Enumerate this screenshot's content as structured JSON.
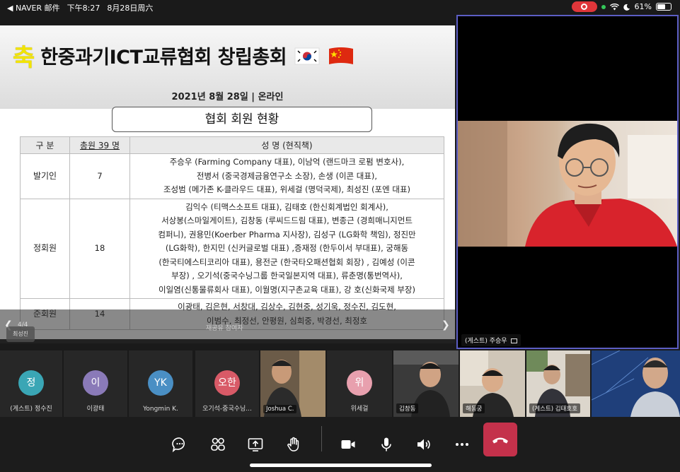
{
  "status_bar": {
    "back_app": "◀ NAVER 邮件",
    "time": "下午8:27",
    "date": "8月28日周六",
    "battery": "61%",
    "battery_level": 0.61
  },
  "slide": {
    "title_mark": "축",
    "title": "한중과기ICT교류협회 창립총회",
    "date_line": "2021년 8월 28일  |  온라인",
    "box_title": "협회 회원 현황",
    "table": {
      "headers": [
        "구 분",
        "총원 39 명",
        "성 명  (현직책)"
      ],
      "rows": [
        {
          "category": "발기인",
          "count": "7",
          "names": [
            "주승우 (Farming Company 대표), 이남억 (랜드마크 로펌 변호사),",
            "전병서 (중국경제금융연구소 소장), 손생 (이콘 대표),",
            "조성범 (메가존 K-클라우드 대표), 위세걸 (명덕국제), 최성진 (포엔 대표)"
          ]
        },
        {
          "category": "정회원",
          "count": "18",
          "names": [
            "김익수 (티맥스소프트 대표), 김태호 (한신회계법인 회계사),",
            "서상봉(스마일게이트), 김창동 (루씨드드림 대표), 변종근 (경희매니지먼트",
            "컴퍼니), 권용민(Koerber Pharma 지사장), 김성구 (LG화학 책임), 정진만",
            "(LG화학), 한지민 (신커글로벌 대표) ,증재정 (한두이서 부대표), 궁해동",
            "(한국티에스티코리아 대표), 용전군 (한국타오패션협회 회장) , 김예성 (이콘",
            "부장) , 오기석(중국수닝그룹 한국일본지역 대표), 류춘명(통번역사),",
            "이일염(신통물류회사 대표), 이월명(지구촌교육 대표), 강 호(신화국제 부장)"
          ]
        },
        {
          "category": "준회원",
          "count": "14",
          "names": [
            "이광태, 김은현, 서창대, 김상수, 김현중, 성기욱, 정수진, 김도현,",
            "이범수, 최정선, 안평원, 심희중, 박경선, 최정호"
          ]
        }
      ]
    },
    "overlay": {
      "page_counter": "4/4",
      "presenter_chip": "최성진",
      "mid_text": "재공유 참여자"
    }
  },
  "main_video": {
    "label": "(게스트) 주승우"
  },
  "participants": [
    {
      "name": "(게스트) 정수진",
      "initials": "정",
      "color": "#3aa6b5",
      "type": "avatar"
    },
    {
      "name": "이광태",
      "initials": "이",
      "color": "#8a7ab8",
      "type": "avatar"
    },
    {
      "name": "Yongmin K.",
      "initials": "YK",
      "color": "#4a8fc4",
      "type": "avatar"
    },
    {
      "name": "오기석-중국수닝...",
      "initials": "오한",
      "color": "#d85a67",
      "type": "avatar"
    },
    {
      "name": "Joshua C.",
      "type": "video"
    },
    {
      "name": "위세걸",
      "initials": "위",
      "color": "#e8a0ae",
      "type": "avatar"
    },
    {
      "name": "김창동",
      "type": "video"
    },
    {
      "name": "해동궁",
      "type": "video"
    },
    {
      "name": "(게스트) 김태호호",
      "type": "video"
    },
    {
      "name": "",
      "type": "video"
    }
  ],
  "toolbar": {
    "buttons": [
      "chat",
      "participants",
      "share",
      "raise-hand",
      "camera",
      "microphone",
      "speaker",
      "more",
      "hang-up"
    ]
  }
}
